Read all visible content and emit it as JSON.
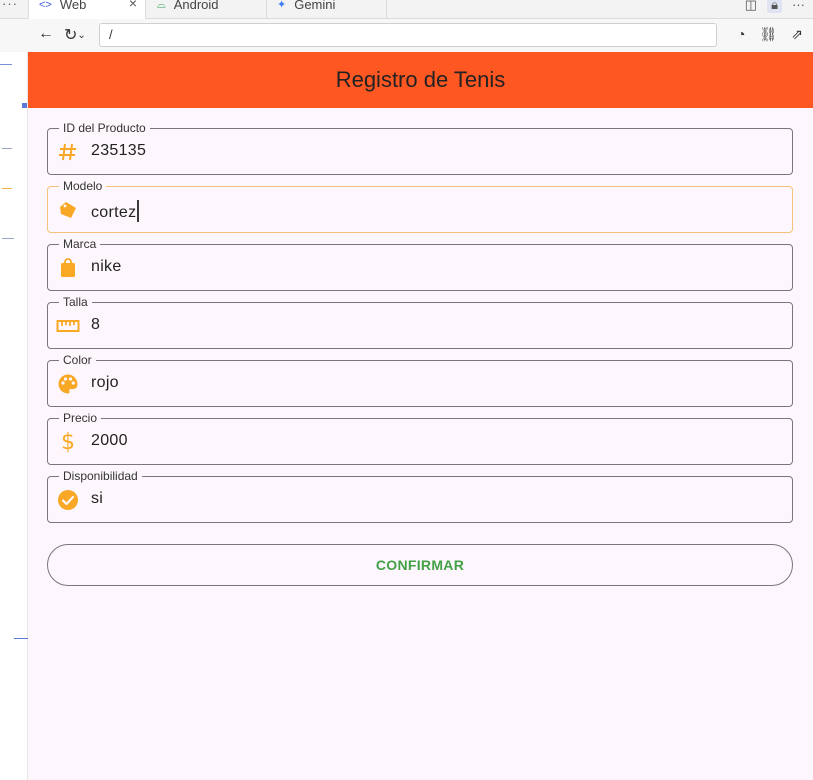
{
  "browser": {
    "tabs": [
      {
        "label": "Web",
        "icon": "code-icon",
        "active": true
      },
      {
        "label": "Android",
        "icon": "android-icon",
        "active": false
      },
      {
        "label": "Gemini",
        "icon": "gemini-sparkle-icon",
        "active": false
      }
    ],
    "url": "/"
  },
  "app": {
    "title": "Registro de Tenis",
    "accent_color": "#ff5722",
    "icon_color": "#f9a825",
    "fields": [
      {
        "label": "ID del Producto",
        "value": "235135",
        "icon": "hash-icon"
      },
      {
        "label": "Modelo",
        "value": "cortez",
        "icon": "label-tag-icon"
      },
      {
        "label": "Marca",
        "value": "nike",
        "icon": "shopping-bag-icon"
      },
      {
        "label": "Talla",
        "value": "8",
        "icon": "ruler-icon"
      },
      {
        "label": "Color",
        "value": "rojo",
        "icon": "palette-icon"
      },
      {
        "label": "Precio",
        "value": "2000",
        "icon": "dollar-icon"
      },
      {
        "label": "Disponibilidad",
        "value": "si",
        "icon": "check-circle-icon"
      }
    ],
    "confirm_label": "CONFIRMAR",
    "confirm_color": "#43a047"
  }
}
